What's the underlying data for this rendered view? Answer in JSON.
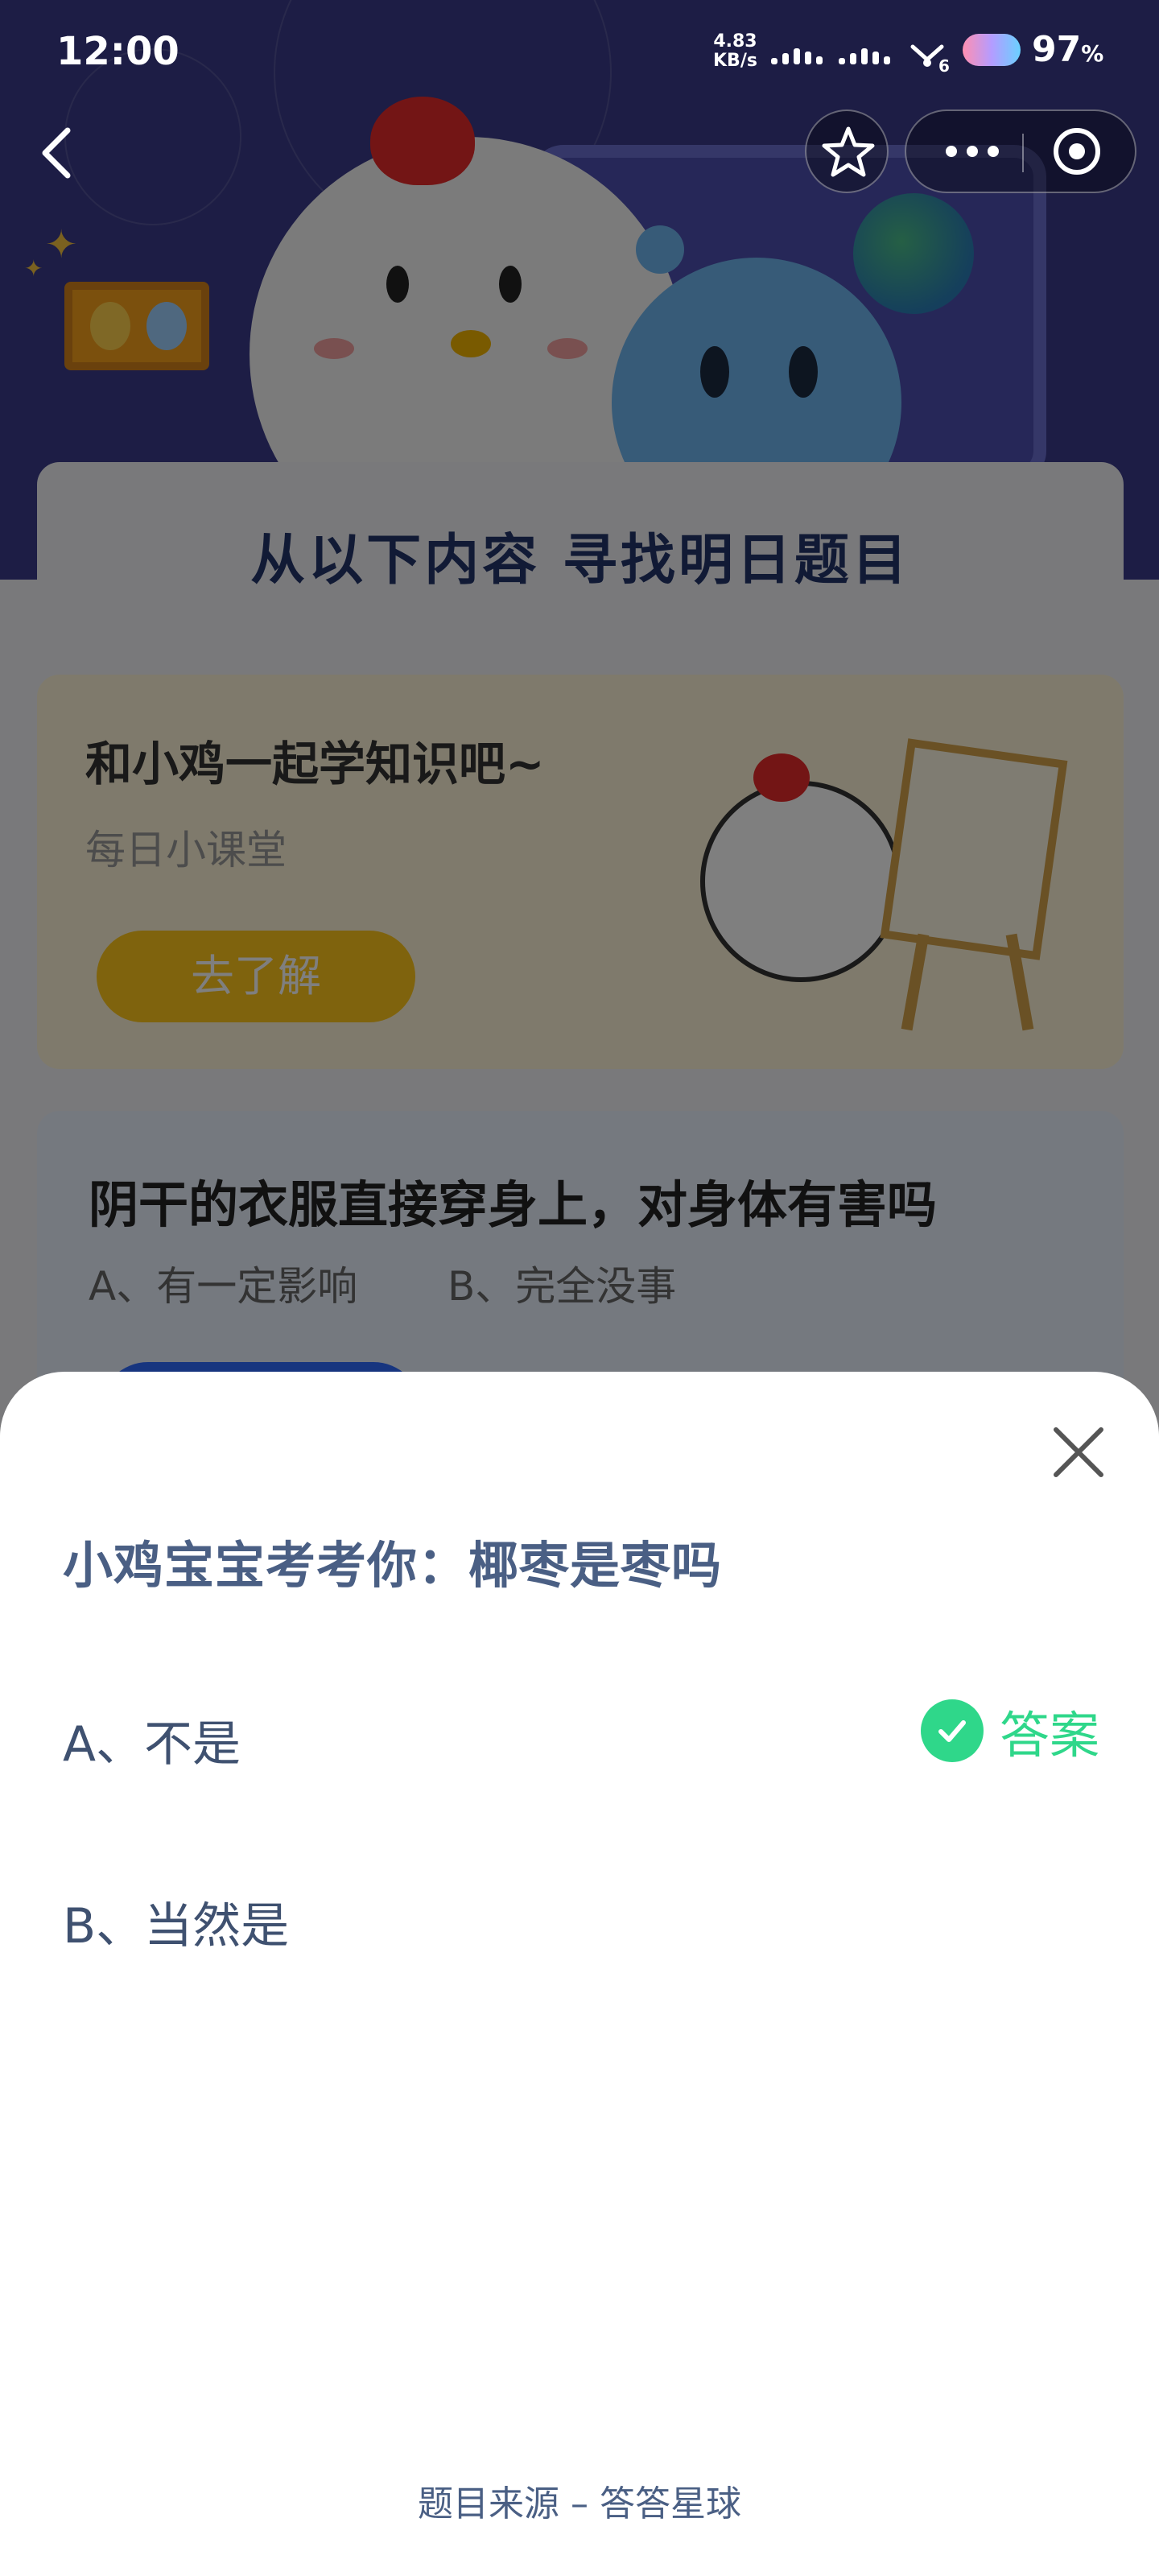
{
  "status_bar": {
    "time": "12:00",
    "net_speed_value": "4.83",
    "net_speed_unit": "KB/s",
    "signal_extra": "6",
    "battery": "97",
    "battery_unit": "%"
  },
  "page": {
    "title": "从以下内容 寻找明日题目",
    "card1": {
      "heading": "和小鸡一起学知识吧~",
      "subtitle": "每日小课堂",
      "button": "去了解"
    },
    "card2": {
      "question": "阴干的衣服直接穿身上，对身体有害吗",
      "option_a": "A、有一定影响",
      "option_b": "B、完全没事"
    }
  },
  "sheet": {
    "question": "小鸡宝宝考考你：椰枣是枣吗",
    "options": [
      {
        "label": "A、不是",
        "is_answer": true
      },
      {
        "label": "B、当然是",
        "is_answer": false
      }
    ],
    "answer_label": "答案",
    "source": "题目来源 – 答答星球"
  },
  "icons": [
    "back-icon",
    "star-icon",
    "more-icon",
    "target-icon",
    "close-icon",
    "check-icon"
  ],
  "colors": {
    "accent_green": "#2fd78a",
    "question_text": "#4a5f84",
    "overlay": "rgba(0,0,0,0.5)"
  }
}
